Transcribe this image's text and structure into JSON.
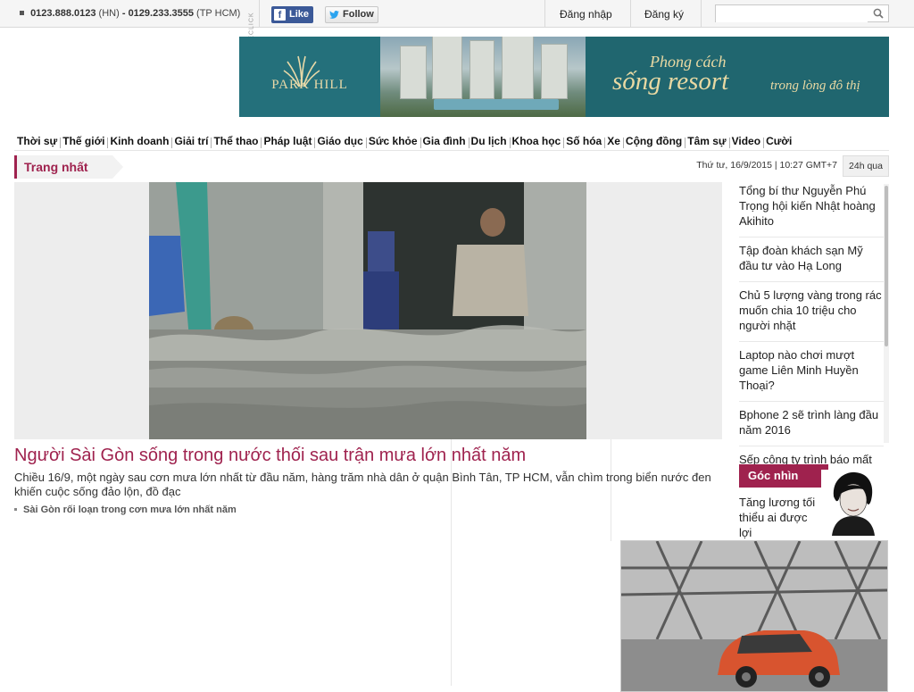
{
  "topbar": {
    "phone_hn": "0123.888.0123",
    "phone_hn_suffix": "(HN)",
    "phone_sep": "-",
    "phone_hcm": "0129.233.3555",
    "phone_hcm_suffix": "(TP HCM)",
    "fb_label": "Like",
    "tw_label": "Follow",
    "login_label": "Đăng nhập",
    "register_label": "Đăng ký",
    "search_placeholder": ""
  },
  "banner": {
    "ad_label": "AD BY ECLICK",
    "brand": "PARK HILL",
    "tagline_1": "Phong cách",
    "tagline_2": "sống resort",
    "tagline_3": "trong lòng đô thị",
    "colors": {
      "bg": "#20666f",
      "gold": "#e9d9a3"
    }
  },
  "nav": {
    "items": [
      "Thời sự",
      "Thế giới",
      "Kinh doanh",
      "Giải trí",
      "Thể thao",
      "Pháp luật",
      "Giáo dục",
      "Sức khỏe",
      "Gia đình",
      "Du lịch",
      "Khoa học",
      "Số hóa",
      "Xe",
      "Cộng đồng",
      "Tâm sự",
      "Video",
      "Cười"
    ]
  },
  "section": {
    "title": "Trang nhất",
    "datetime": "Thứ tư, 16/9/2015 | 10:27 GMT+7",
    "recent_label": "24h qua",
    "accent": "#9f224e"
  },
  "main_story": {
    "headline": "Người Sài Gòn sống trong nước thối sau trận mưa lớn nhất năm",
    "lead": "Chiều 16/9, một ngày sau cơn mưa lớn nhất từ đầu năm, hàng trăm nhà dân ở quận Bình Tân, TP HCM, vẫn chìm trong biển nước đen khiến cuộc sống đảo lộn, đồ đạc",
    "related": "Sài Gòn rối loạn trong cơn mưa lớn nhất năm"
  },
  "side_news": [
    "Tổng bí thư Nguyễn Phú Trọng hội kiến Nhật hoàng Akihito",
    "Tập đoàn khách sạn Mỹ đầu tư vào Hạ Long",
    "Chủ 5 lượng vàng trong rác muốn chia 10 triệu cho người nhặt",
    "Laptop nào chơi mượt game Liên Minh Huyền Thoại?",
    "Bphone 2 sẽ trình làng đầu năm 2016",
    "Sếp công ty trình báo mất"
  ],
  "goc_nhin": {
    "title": "Góc nhìn",
    "text": "Tăng lương tối thiểu ai được lợi"
  }
}
